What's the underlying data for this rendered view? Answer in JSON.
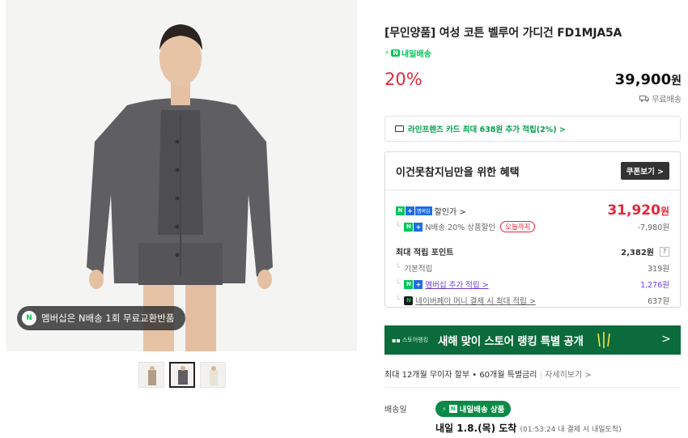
{
  "gallery": {
    "member_badge": "멤버십은 N배송 1회 무료교환반품",
    "thumbnail_count": 3
  },
  "product": {
    "title": "[무인양품] 여성 코튼 벨루어 가디건 FD1MJA5A",
    "delivery_tag": "내일배송",
    "discount_rate": "20%",
    "price": "39,900",
    "price_unit": "원",
    "shipping": "무료배송"
  },
  "card_offer": {
    "text": "라인프렌즈 카드 최대 638원 추가 적립(2%) >"
  },
  "benefits": {
    "heading": "이건못참지님만을 위한 혜택",
    "coupon_button": "쿠폰보기 >",
    "sale_label": "할인가 >",
    "membership_mini_tag": "멤버십",
    "sale_price": "31,920",
    "sale_price_unit": "원",
    "discount_line": "N배송 20% 상품할인",
    "discount_chip": "오늘까지",
    "discount_amount": "-7,980원",
    "points_label": "최대 적립 포인트",
    "points_total": "2,382원",
    "points_help": "?",
    "basic_label": "기본적립",
    "basic_value": "319원",
    "membership_label": "멤버십 추가 적립 >",
    "membership_value": "1,276원",
    "npay_label": "네이버페이 머니 결제 시 최대 적립 >",
    "npay_value": "637원"
  },
  "banner": {
    "tag": "스토어랭킹",
    "message": "새해 맞이 스토어 랭킹 특별 공개",
    "arrow": ">"
  },
  "installment": {
    "text": "최대 12개월 무이자 할부 • 60개월 특별금리",
    "link": "자세히보기 >"
  },
  "delivery": {
    "label": "배송일",
    "pill": "내일배송 상품",
    "date": "내일 1.8.(목) 도착",
    "note": "(01:53:24 내 결제 시 내일도착)"
  },
  "colors": {
    "accent_green": "#03c75a",
    "discount_red": "#e5273b",
    "banner_green": "#0b6b3b",
    "membership_purple": "#6b3cd9"
  }
}
